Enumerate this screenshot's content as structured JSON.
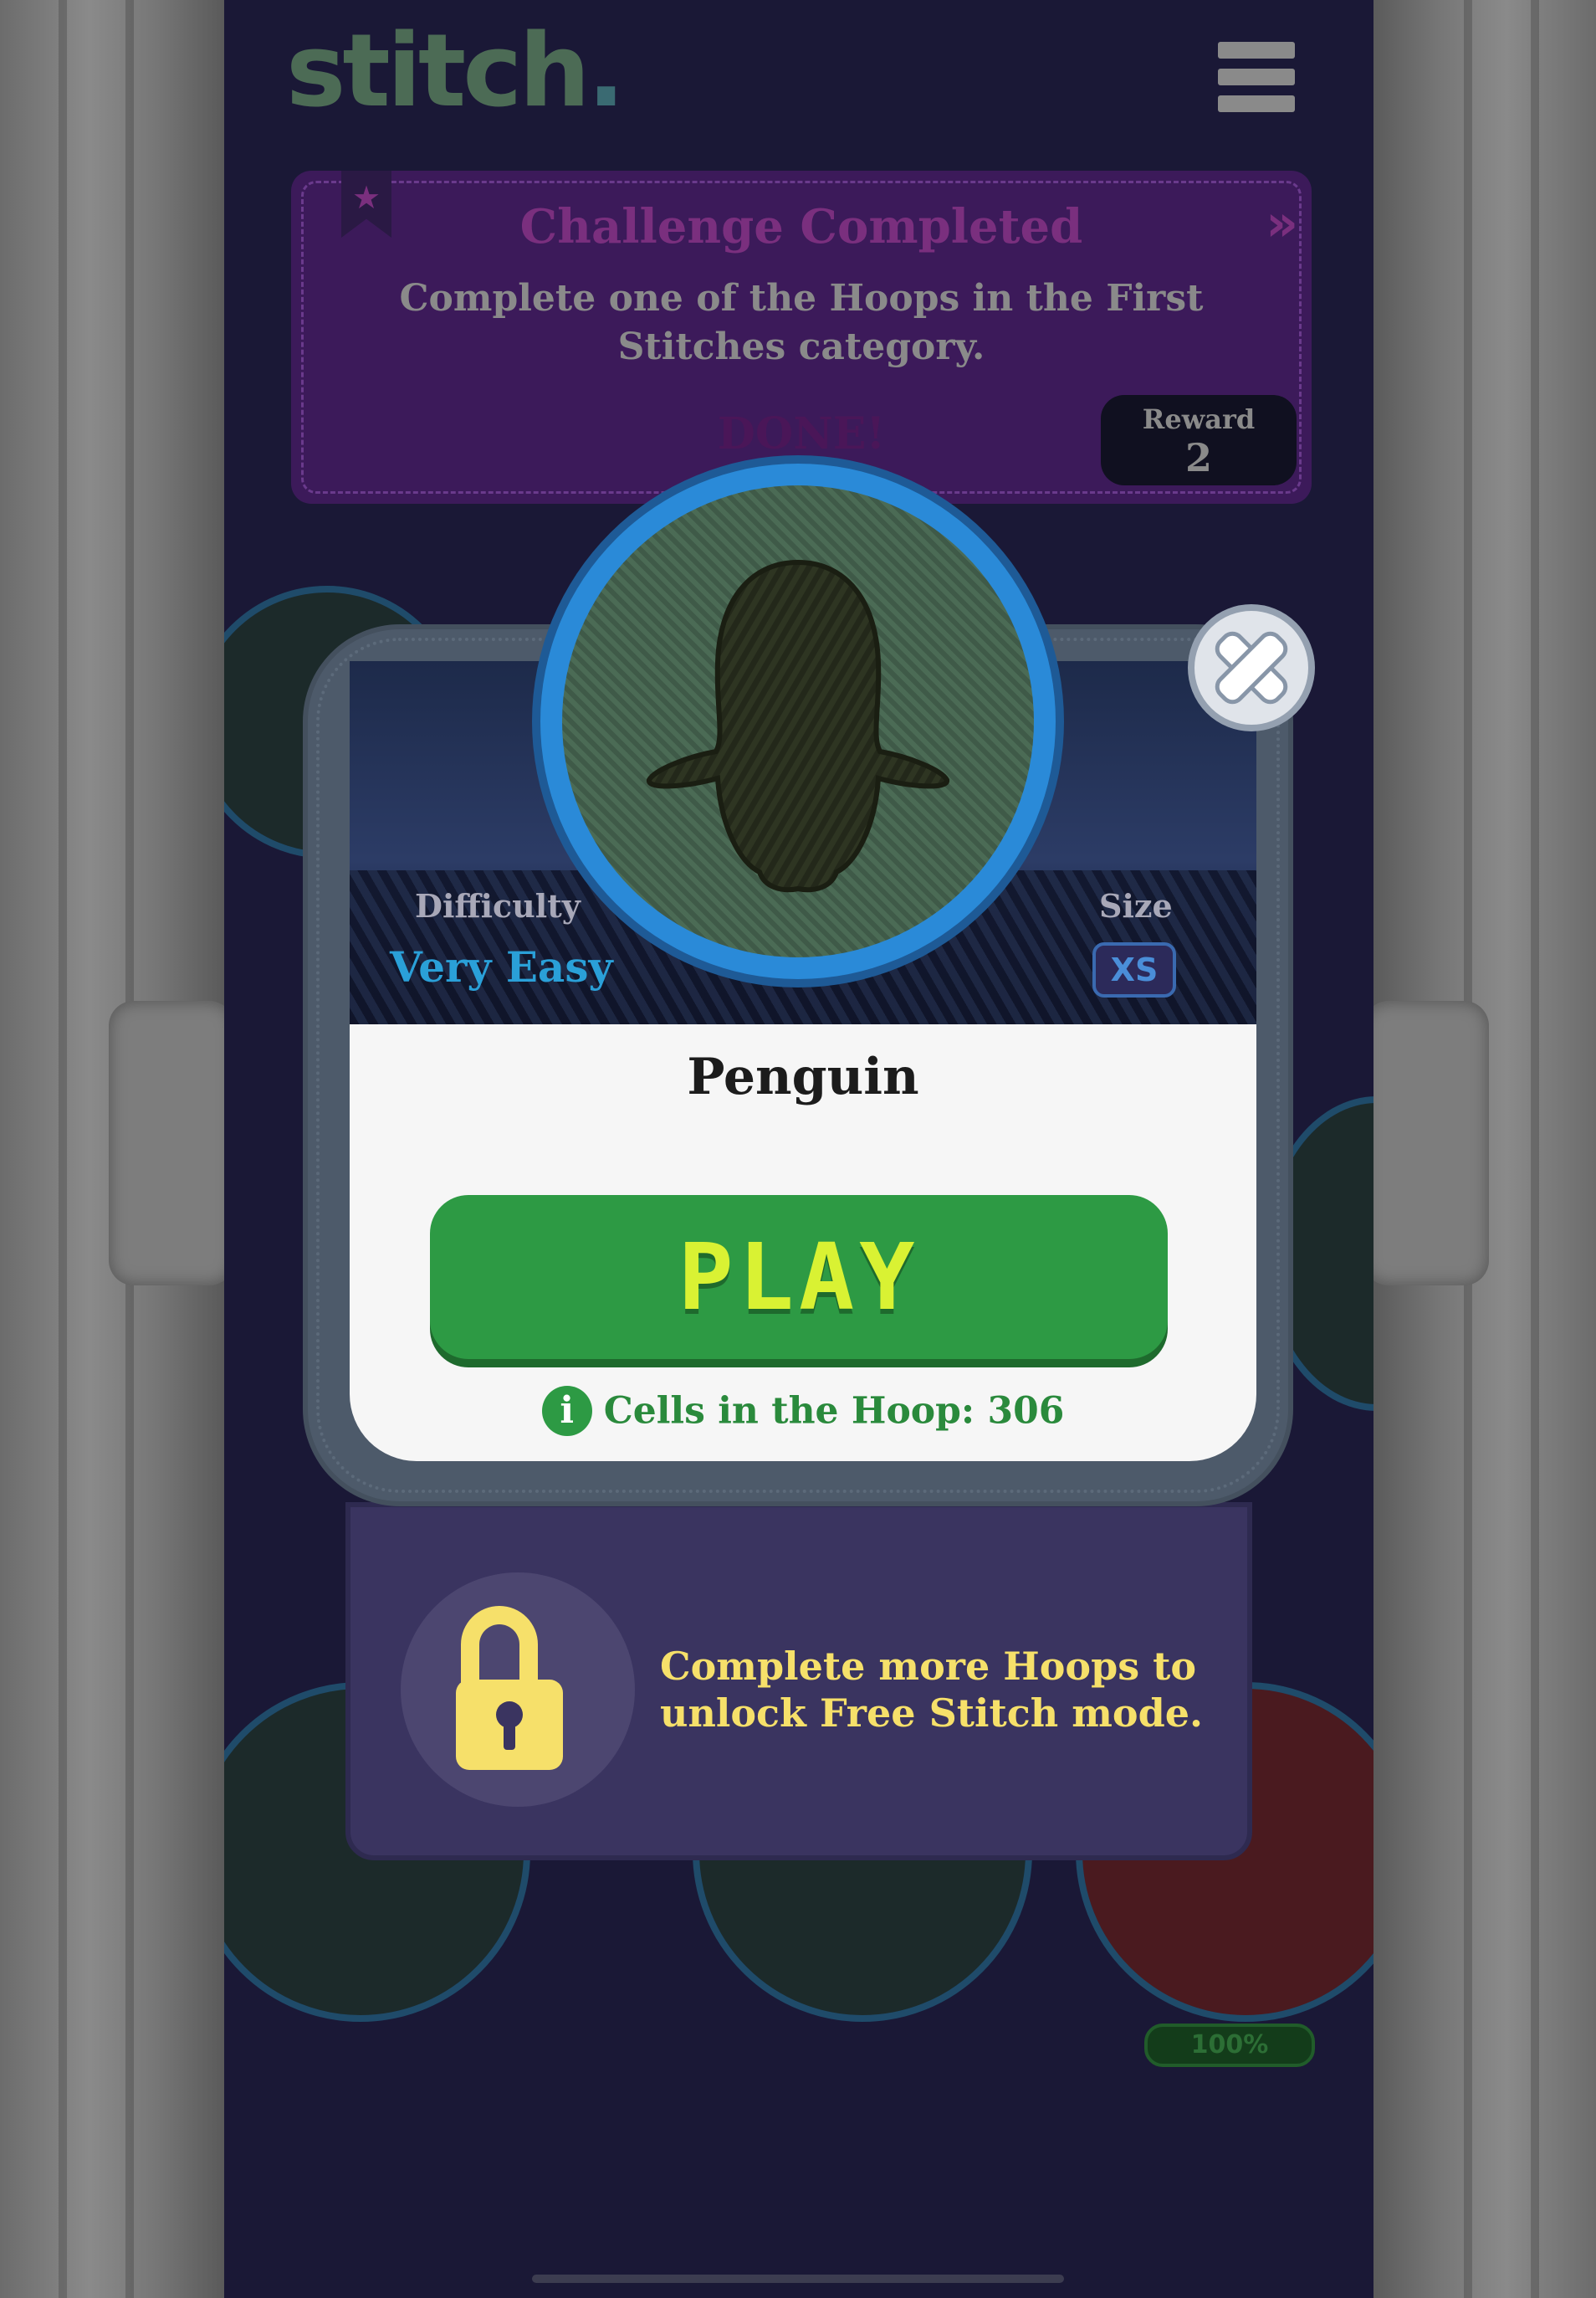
{
  "app": {
    "logo": "stitch",
    "logo_dot": "."
  },
  "header": {
    "menu_icon": "hamburger-menu-icon"
  },
  "challenge": {
    "title": "Challenge Completed",
    "arrows": "»",
    "description": "Complete one of the Hoops in the First Stitches category.",
    "status": "DONE!",
    "reward_label": "Reward",
    "reward_value": "2"
  },
  "modal": {
    "difficulty_label": "Difficulty",
    "difficulty_value": "Very Easy",
    "size_label": "Size",
    "size_value": "XS",
    "name": "Penguin",
    "play_label": "PLAY",
    "info_icon": "i",
    "info_text": "Cells in the Hoop: 306"
  },
  "unlock": {
    "message": "Complete more Hoops to unlock Free Stitch mode."
  },
  "background": {
    "progress_label": "100%"
  },
  "colors": {
    "play_green": "#2d9a44",
    "play_text": "#d9f233",
    "difficulty_blue": "#2aa0d8",
    "unlock_yellow": "#f6e06a",
    "patch_ring_blue": "#2a8ad8"
  }
}
